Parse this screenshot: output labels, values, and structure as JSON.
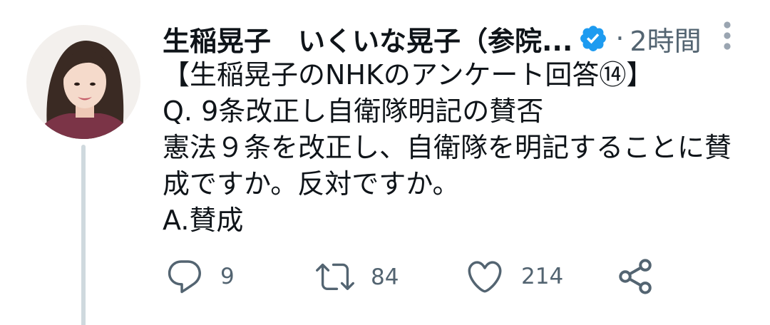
{
  "tweet": {
    "author": {
      "display_name": "生稲晃子　いくいな晃子（参院...",
      "verified": true,
      "avatar_icon": "avatar-photo"
    },
    "separator": "·",
    "timestamp": "2時間",
    "more_icon": "more-vertical-icon",
    "text_lines": [
      "【生稲晃子のNHKのアンケート回答⑭】",
      "Q. 9条改正し自衛隊明記の賛否",
      "憲法９条を改正し、自衛隊を明記することに賛",
      "成ですか。反対ですか。",
      "A.賛成"
    ],
    "actions": {
      "reply": {
        "icon": "reply-icon",
        "count": "9"
      },
      "retweet": {
        "icon": "retweet-icon",
        "count": "84"
      },
      "like": {
        "icon": "heart-icon",
        "count": "214"
      },
      "share": {
        "icon": "share-icon"
      }
    }
  },
  "colors": {
    "text": "#0f1419",
    "secondary": "#536471",
    "verified": "#1d9bf0",
    "thread": "#cfd9de",
    "more": "#9aa5b1"
  }
}
